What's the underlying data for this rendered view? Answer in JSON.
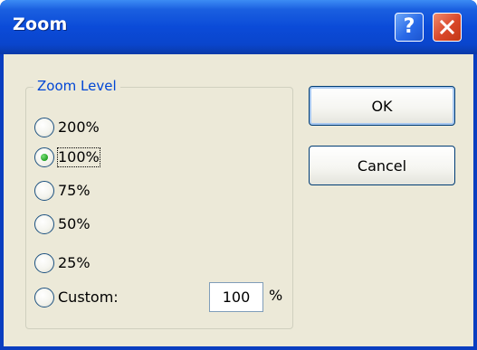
{
  "window": {
    "title": "Zoom",
    "help_glyph": "?",
    "icons": [
      "help-icon",
      "close-icon"
    ]
  },
  "group": {
    "label": "Zoom Level"
  },
  "options": [
    {
      "label": "200%",
      "checked": false
    },
    {
      "label": "100%",
      "checked": true
    },
    {
      "label": "75%",
      "checked": false
    },
    {
      "label": "50%",
      "checked": false
    },
    {
      "label": "25%",
      "checked": false
    },
    {
      "label": "Custom:",
      "checked": false
    }
  ],
  "custom": {
    "value": "100",
    "unit": "%"
  },
  "buttons": {
    "ok_label": "OK",
    "cancel_label": "Cancel"
  },
  "colors": {
    "titlebar": "#0a45cc",
    "dialog_face": "#ece9d8",
    "group_label": "#0046d5",
    "close_button": "#d9472a",
    "radio_dot": "#21a121"
  }
}
